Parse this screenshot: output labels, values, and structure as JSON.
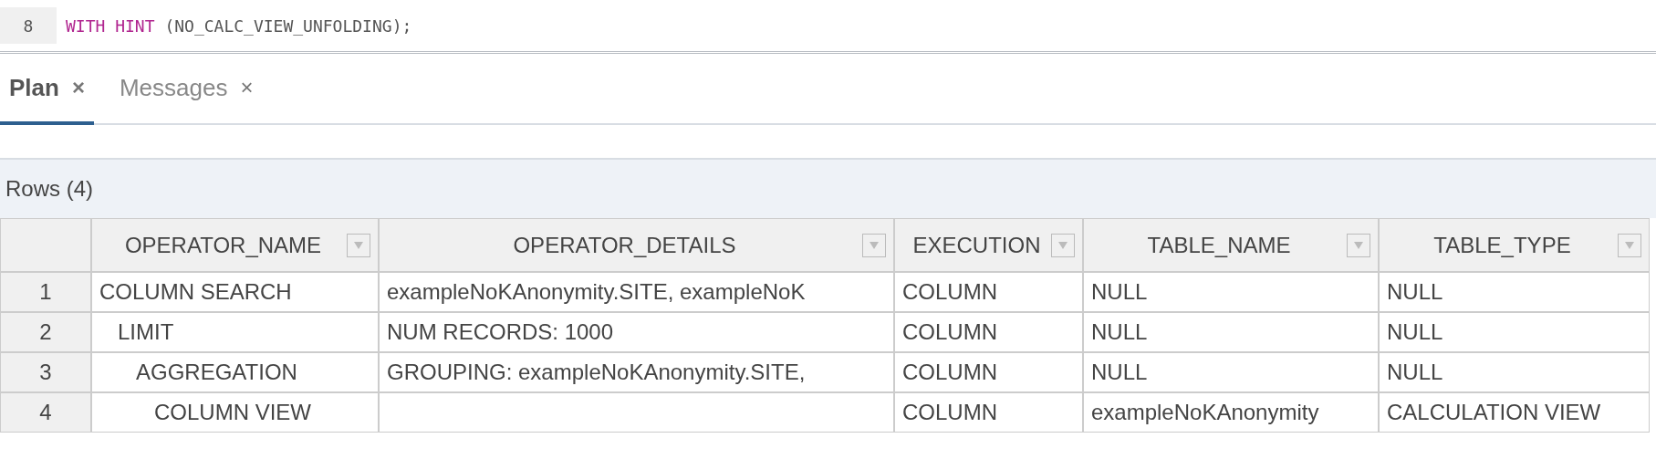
{
  "editor": {
    "lines": [
      {
        "number": "8",
        "tokens": [
          {
            "kind": "keyword",
            "text": "WITH HINT"
          },
          {
            "kind": "plain",
            "text": " (NO_CALC_VIEW_UNFOLDING);"
          }
        ]
      }
    ]
  },
  "tabs": [
    {
      "label": "Plan",
      "close": "×",
      "selected": true
    },
    {
      "label": "Messages",
      "close": "×",
      "selected": false
    }
  ],
  "result": {
    "summary": "Rows (4)",
    "columns": [
      "",
      "OPERATOR_NAME",
      "OPERATOR_DETAILS",
      "EXECUTION",
      "TABLE_NAME",
      "TABLE_TYPE"
    ],
    "rows": [
      {
        "cells": [
          "1",
          "COLUMN SEARCH",
          "exampleNoKAnonymity.SITE, exampleNoK",
          "COLUMN",
          "NULL",
          "NULL"
        ],
        "children": [
          {
            "cells": [
              "2",
              "LIMIT",
              "NUM RECORDS: 1000",
              "COLUMN",
              "NULL",
              "NULL"
            ],
            "children": [
              {
                "cells": [
                  "3",
                  "AGGREGATION",
                  "GROUPING: exampleNoKAnonymity.SITE,",
                  "COLUMN",
                  "NULL",
                  "NULL"
                ],
                "children": [
                  {
                    "cells": [
                      "4",
                      "COLUMN VIEW",
                      "",
                      "COLUMN",
                      "exampleNoKAnonymity",
                      "CALCULATION VIEW"
                    ]
                  }
                ]
              }
            ]
          }
        ]
      }
    ]
  }
}
